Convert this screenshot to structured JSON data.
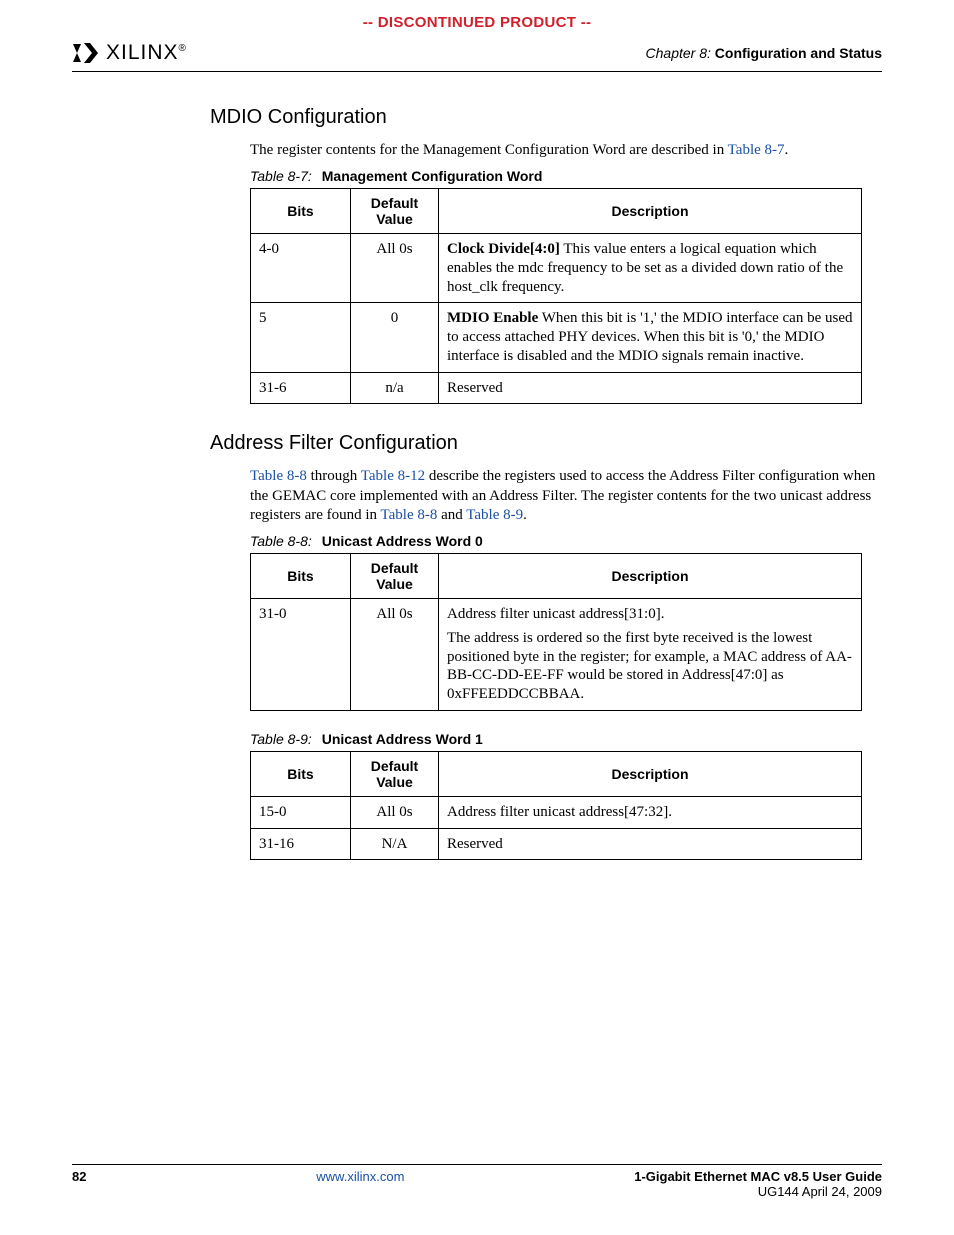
{
  "banner": "-- DISCONTINUED PRODUCT --",
  "logo": {
    "brand": "XILINX",
    "mark": "®"
  },
  "chapter": {
    "prefix": "Chapter 8:",
    "title": "Configuration and Status"
  },
  "sec1": {
    "heading": "MDIO Configuration",
    "intro_a": "The register contents for the Management Configuration Word are described in ",
    "intro_link": "Table 8-7",
    "intro_b": ".",
    "caption_num": "Table 8-7:",
    "caption_txt": "Management Configuration Word",
    "th": {
      "bits": "Bits",
      "def": "Default Value",
      "desc": "Description"
    },
    "rows": [
      {
        "bits": "4-0",
        "def": "All 0s",
        "desc_b": "Clock Divide[4:0]",
        "desc_r": " This value enters a logical equation which enables the mdc frequency to be set as a divided down ratio of the host_clk frequency."
      },
      {
        "bits": "5",
        "def": "0",
        "desc_b": "MDIO Enable",
        "desc_r": " When this bit is '1,' the MDIO interface can be used to access attached PHY devices. When this bit is '0,' the MDIO interface is disabled and the MDIO signals remain inactive."
      },
      {
        "bits": "31-6",
        "def": "n/a",
        "desc_b": "",
        "desc_r": "Reserved"
      }
    ]
  },
  "sec2": {
    "heading": "Address Filter Configuration",
    "p": {
      "a": "",
      "l1": "Table 8-8",
      "b": " through ",
      "l2": "Table 8-12",
      "c": " describe the registers used to access the Address Filter configuration when the GEMAC core implemented with an Address Filter. The register contents for the two unicast address registers are found in ",
      "l3": "Table 8-8",
      "d": " and ",
      "l4": "Table 8-9",
      "e": "."
    },
    "t88": {
      "caption_num": "Table 8-8:",
      "caption_txt": "Unicast Address Word 0",
      "th": {
        "bits": "Bits",
        "def": "Default Value",
        "desc": "Description"
      },
      "row": {
        "bits": "31-0",
        "def": "All 0s",
        "p1": "Address filter unicast address[31:0].",
        "p2": "The address is ordered so the first byte received is the lowest positioned byte in the register; for example, a MAC address of AA-BB-CC-DD-EE-FF would be stored in Address[47:0] as 0xFFEEDDCCBBAA."
      }
    },
    "t89": {
      "caption_num": "Table 8-9:",
      "caption_txt": "Unicast Address Word 1",
      "th": {
        "bits": "Bits",
        "def": "Default Value",
        "desc": "Description"
      },
      "rows": [
        {
          "bits": "15-0",
          "def": "All 0s",
          "desc": "Address filter unicast address[47:32]."
        },
        {
          "bits": "31-16",
          "def": "N/A",
          "desc": "Reserved"
        }
      ]
    }
  },
  "footer": {
    "page": "82",
    "url": "www.xilinx.com",
    "title": "1-Gigabit Ethernet MAC v8.5 User Guide",
    "sub": "UG144 April 24, 2009"
  }
}
